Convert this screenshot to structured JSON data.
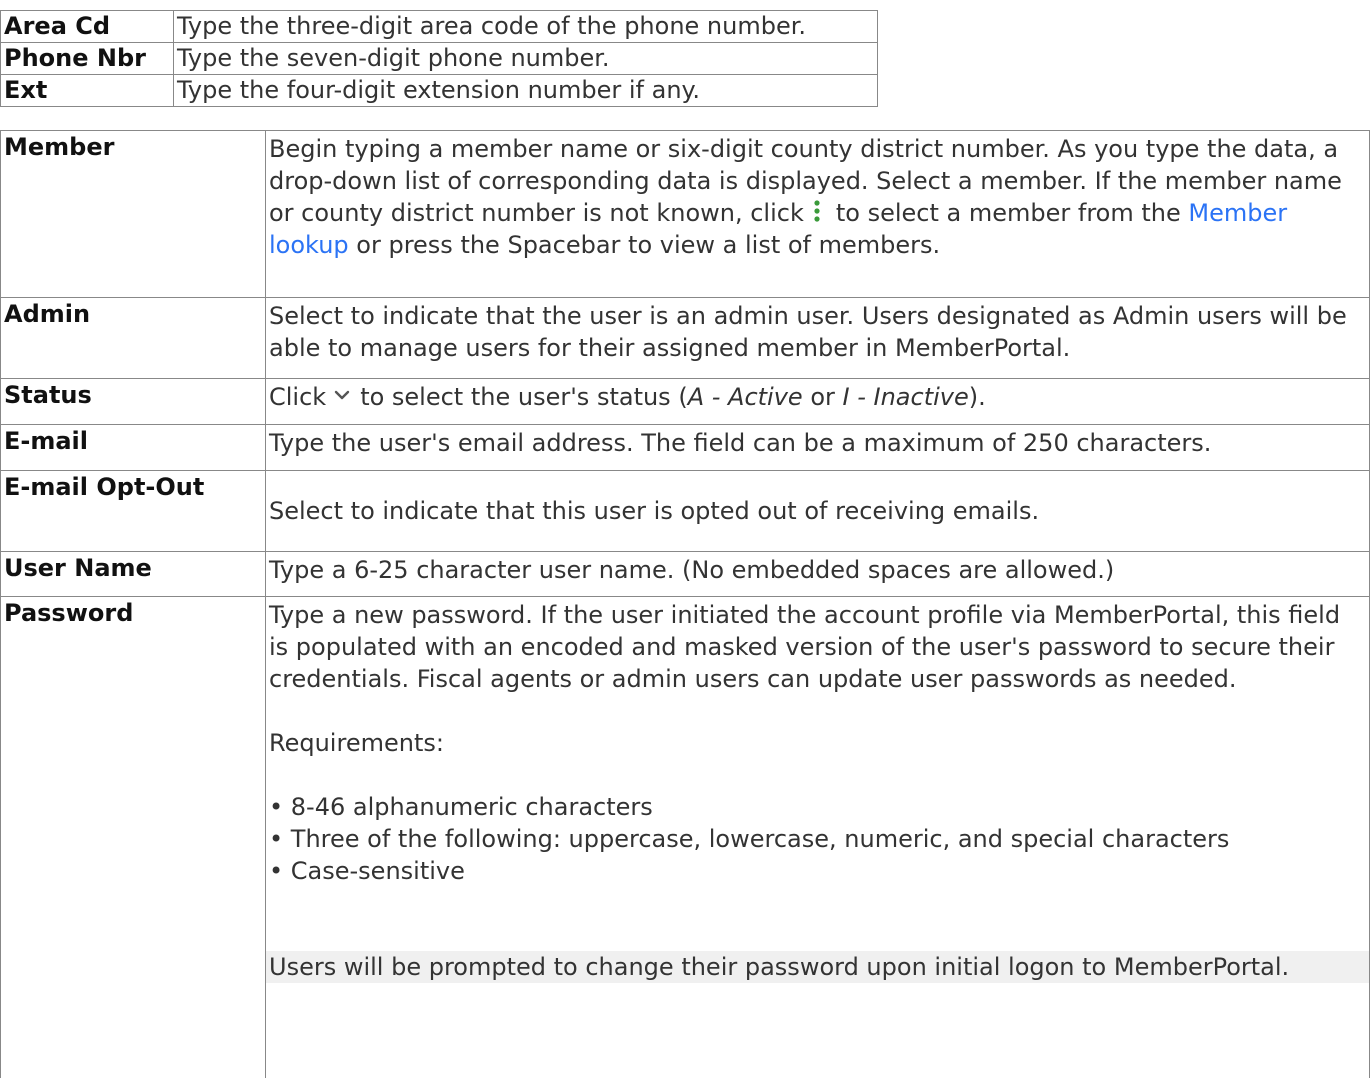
{
  "phone_fields": [
    {
      "label": "Area Cd",
      "desc": "Type the three-digit area code of the phone number."
    },
    {
      "label": "Phone Nbr",
      "desc": "Type the seven-digit phone number."
    },
    {
      "label": "Ext",
      "desc": "Type the four-digit extension number if any."
    }
  ],
  "fields": {
    "member": {
      "label": "Member",
      "desc_a": "Begin typing a member name or six-digit county district number. As you type the data, a drop-down list of corresponding data is displayed. Select a member. If the member name or county district number is not known, click",
      "desc_b": "to select a member from the",
      "link": "Member lookup",
      "desc_c": "or press the Spacebar to view a list of members.",
      "icon": "vertical-dots-icon"
    },
    "admin": {
      "label": "Admin",
      "desc": "Select to indicate that the user is an admin user. Users designated as Admin users will be able to manage users for their assigned member in MemberPortal."
    },
    "status": {
      "label": "Status",
      "desc_a": "Click",
      "desc_b": "to select the user's status (",
      "opt_a": "A - Active",
      "desc_c": " or ",
      "opt_i": "I - Inactive",
      "desc_d": ").",
      "icon": "chevron-down-icon"
    },
    "email": {
      "label": "E-mail",
      "desc": "Type the user's email address. The field can be a maximum of 250 characters."
    },
    "optout": {
      "label": "E-mail Opt-Out",
      "desc": "Select to indicate that this user is opted out of receiving emails."
    },
    "username": {
      "label": "User Name",
      "desc": "Type a 6-25 character user name. (No embedded spaces are allowed.)"
    },
    "password": {
      "label": "Password",
      "desc": "Type a new password. If the user initiated the account profile via MemberPortal, this field is populated with an encoded and masked version of the user's password to secure their credentials. Fiscal agents or admin users can update user passwords as needed.",
      "req_heading": "Requirements:",
      "requirements": [
        "• 8-46 alphanumeric characters",
        "• Three of the following: uppercase, lowercase, numeric, and special characters",
        "• Case-sensitive"
      ],
      "note": "Users will be prompted to change their password upon initial logon to MemberPortal."
    }
  },
  "colors": {
    "link": "#2b73f5",
    "icon_green": "#3a9a3a",
    "note_bg": "#f0f0f0",
    "border": "#888888"
  }
}
